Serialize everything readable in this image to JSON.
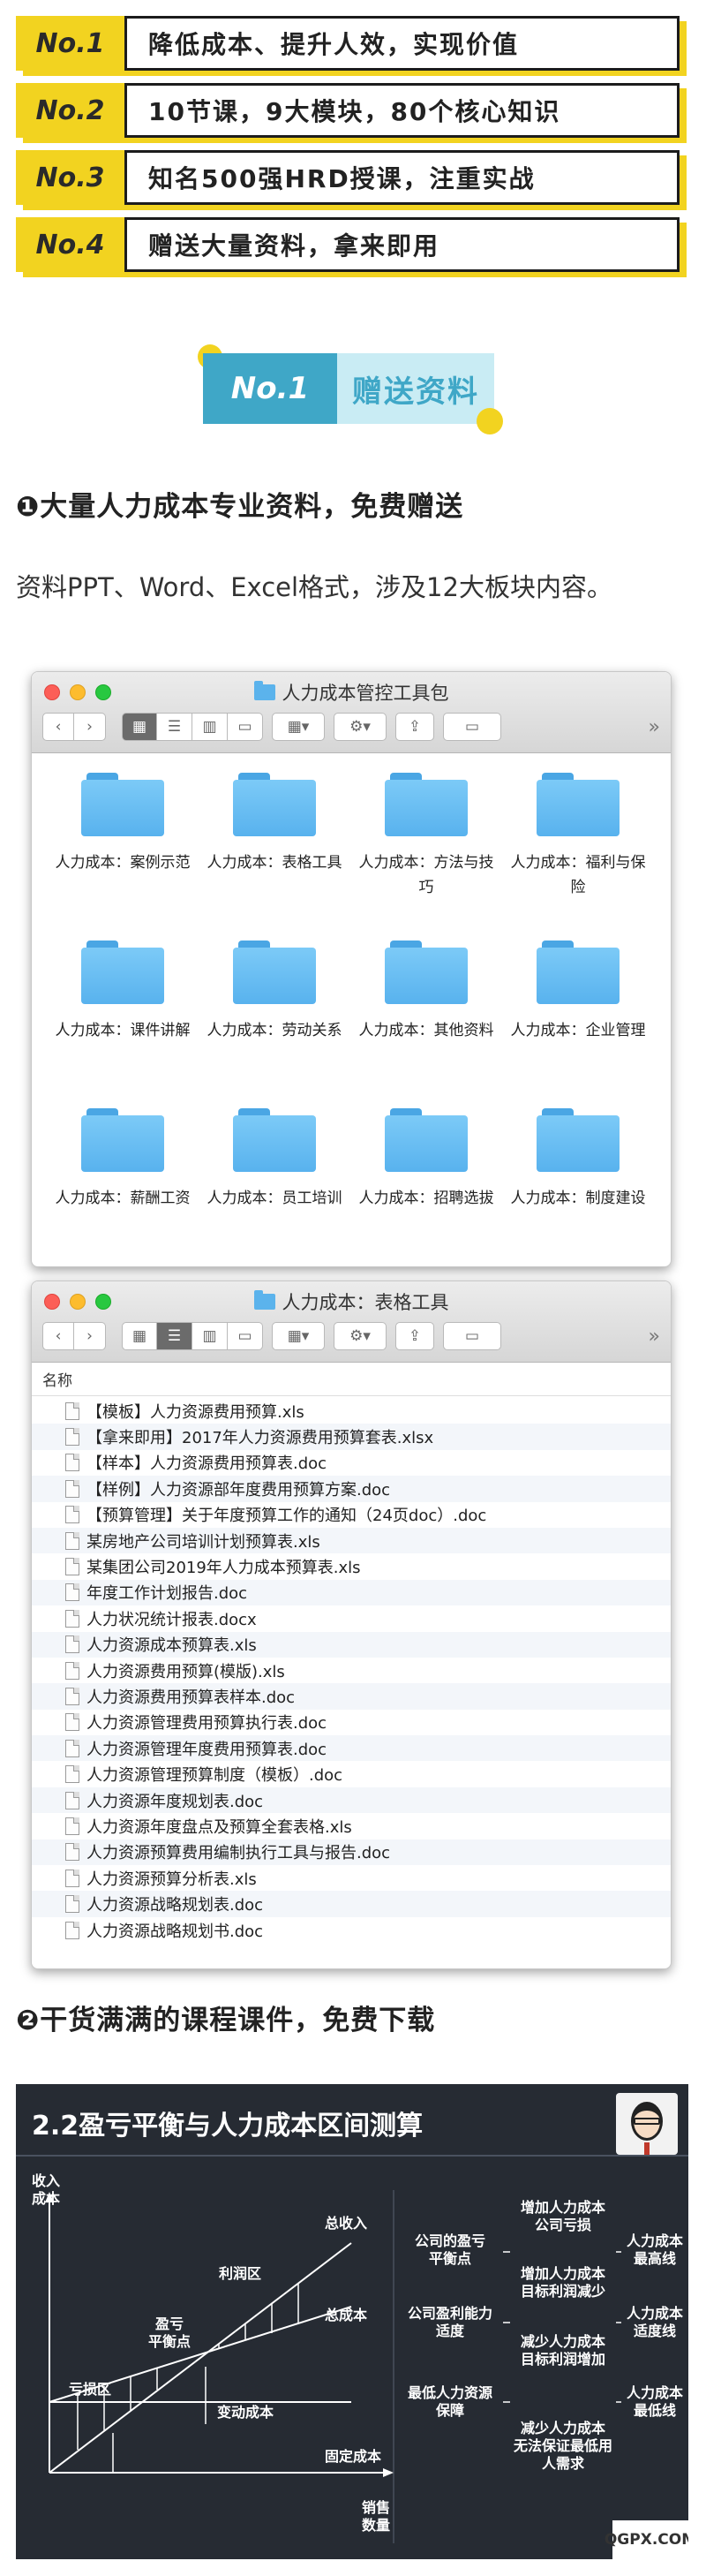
{
  "features": [
    {
      "tag": "No.1",
      "text": "降低成本、提升人效，实现价值"
    },
    {
      "tag": "No.2",
      "text": "10节课，9大模块，80个核心知识"
    },
    {
      "tag": "No.3",
      "text": "知名500强HRD授课，注重实战"
    },
    {
      "tag": "No.4",
      "text": "赠送大量资料，拿来即用"
    }
  ],
  "section_badge": {
    "tag": "No.1",
    "label": "赠送资料"
  },
  "heading1": "❶大量人力成本专业资料，免费赠送",
  "para1": "资料PPT、Word、Excel格式，涉及12大板块内容。",
  "window1": {
    "title": "人力成本管控工具包",
    "folders": [
      "人力成本：案例示范",
      "人力成本：表格工具",
      "人力成本：方法与技巧",
      "人力成本：福利与保险",
      "人力成本：课件讲解",
      "人力成本：劳动关系",
      "人力成本：其他资料",
      "人力成本：企业管理",
      "人力成本：薪酬工资",
      "人力成本：员工培训",
      "人力成本：招聘选拔",
      "人力成本：制度建设"
    ]
  },
  "window2": {
    "title": "人力成本：表格工具",
    "column_name": "名称",
    "files": [
      "【模板】人力资源费用预算.xls",
      "【拿来即用】2017年人力资源费用预算套表.xlsx",
      "【样本】人力资源费用预算表.doc",
      "【样例】人力资源部年度费用预算方案.doc",
      "【预算管理】关于年度预算工作的通知（24页doc）.doc",
      "某房地产公司培训计划预算表.xls",
      "某集团公司2019年人力成本预算表.xls",
      "年度工作计划报告.doc",
      "人力状况统计报表.docx",
      "人力资源成本预算表.xls",
      "人力资源费用预算(模版).xls",
      "人力资源费用预算表样本.doc",
      "人力资源管理费用预算执行表.doc",
      "人力资源管理年度费用预算表.doc",
      "人力资源管理预算制度（模板）.doc",
      "人力资源年度规划表.doc",
      "人力资源年度盘点及预算全套表格.xls",
      "人力资源预算费用编制执行工具与报告.doc",
      "人力资源预算分析表.xls",
      "人力资源战略规划表.doc",
      "人力资源战略规划书.doc"
    ]
  },
  "heading2": "❷干货满满的课程课件，免费下载",
  "slide": {
    "title": "2.2盈亏平衡与人力成本区间测算",
    "y_axis": "收入\n成本",
    "x_axis": "销售\n数量",
    "labels": {
      "total_revenue": "总收入",
      "total_cost": "总成本",
      "profit_zone": "利润区",
      "breakeven": "盈亏\n平衡点",
      "loss_zone": "亏损区",
      "variable_cost": "变动成本",
      "fixed_cost": "固定成本"
    },
    "right": {
      "r1a": "增加人力成本\n公司亏损",
      "r1b": "公司的盈亏\n平衡点",
      "r1c": "增加人力成本\n目标利润减少",
      "r1d": "人力成本\n最高线",
      "r2a": "公司盈利能力\n适度",
      "r2b": "减少人力成本\n目标利润增加",
      "r2c": "人力成本\n适度线",
      "r3a": "最低人力资源\n保障",
      "r3b": "减少人力成本\n无法保证最低用\n人需求",
      "r3c": "人力成本\n最低线"
    }
  },
  "watermark": "QGPX.COM"
}
